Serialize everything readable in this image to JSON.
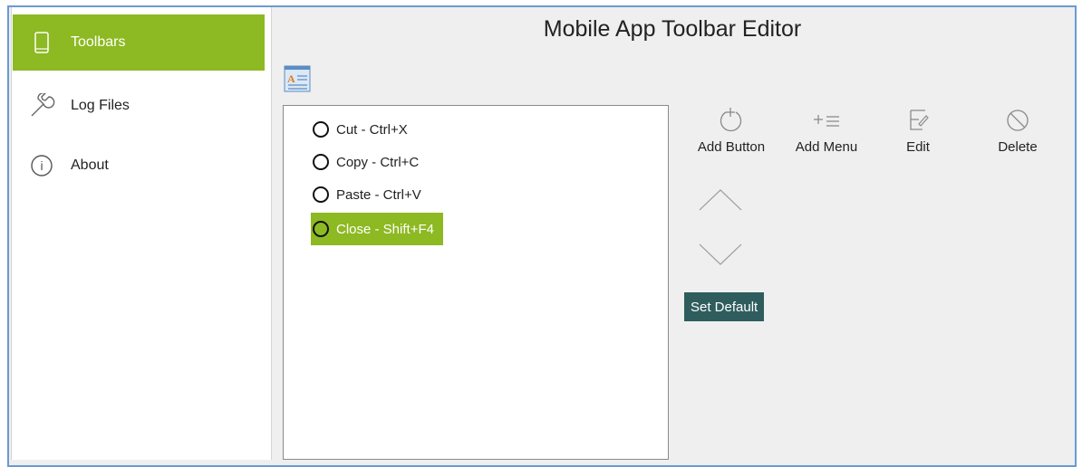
{
  "app": {
    "title": "Mobile App Toolbar Editor"
  },
  "sidebar": {
    "items": [
      {
        "label": "Toolbars",
        "icon": "phone-icon",
        "active": true
      },
      {
        "label": "Log Files",
        "icon": "wrench-icon",
        "active": false
      },
      {
        "label": "About",
        "icon": "info-icon",
        "active": false
      }
    ]
  },
  "toolbar_list": {
    "items": [
      {
        "label": "Cut - Ctrl+X",
        "selected": false
      },
      {
        "label": "Copy - Ctrl+C",
        "selected": false
      },
      {
        "label": "Paste - Ctrl+V",
        "selected": false
      },
      {
        "label": "Close - Shift+F4",
        "selected": true
      }
    ]
  },
  "actions": {
    "add_button": "Add Button",
    "add_menu": "Add Menu",
    "edit": "Edit",
    "delete": "Delete",
    "set_default": "Set Default"
  },
  "colors": {
    "accent": "#8db922",
    "frame": "#6a9bd1",
    "set_default_bg": "#2f5d5e"
  }
}
